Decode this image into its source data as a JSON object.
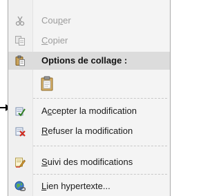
{
  "menu": {
    "items": [
      {
        "pre": "Cou",
        "key": "p",
        "post": "er",
        "icon": "scissors-icon",
        "disabled": true
      },
      {
        "pre": "",
        "key": "C",
        "post": "opier",
        "icon": "copy-icon",
        "disabled": true
      },
      {
        "label": "Options de collage :",
        "icon": "clipboard-icon"
      },
      {
        "pre": "A",
        "key": "c",
        "post": "cepter la modification",
        "icon": "accept-change-icon"
      },
      {
        "pre": "",
        "key": "R",
        "post": "efuser la modification",
        "icon": "reject-change-icon"
      },
      {
        "pre": "",
        "key": "S",
        "post": "uivi des modifications",
        "icon": "track-changes-icon"
      },
      {
        "pre": "",
        "key": "L",
        "post": "ien hypertexte...",
        "icon": "hyperlink-icon"
      }
    ],
    "paste_option_icon": "paste-keep-formatting-icon"
  },
  "colors": {
    "disabled_text": "#9c9c9c",
    "header_bg": "#dcdcdc",
    "menu_bg": "#f4f4f4"
  },
  "pointer_icon": "arrow-pointer-icon"
}
